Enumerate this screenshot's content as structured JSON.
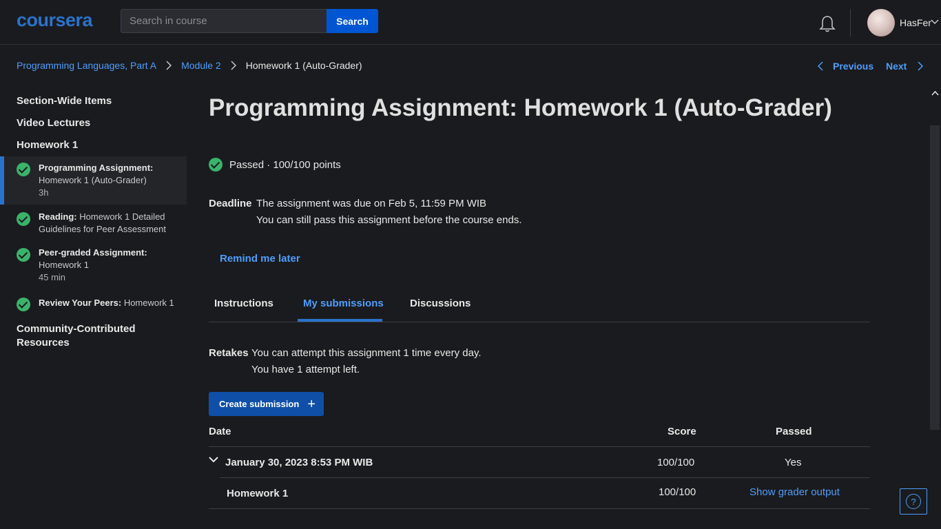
{
  "header": {
    "logo": "coursera",
    "search_placeholder": "Search in course",
    "search_button": "Search",
    "username": "HasFer"
  },
  "breadcrumb": {
    "items": [
      "Programming Languages, Part A",
      "Module 2"
    ],
    "current": "Homework 1 (Auto-Grader)",
    "previous": "Previous",
    "next": "Next"
  },
  "sidebar": {
    "sections": [
      "Section-Wide Items",
      "Video Lectures",
      "Homework 1",
      "Community-Contributed Resources"
    ],
    "items": [
      {
        "type": "Programming Assignment:",
        "title": "Homework 1 (Auto-Grader)",
        "duration": "3h"
      },
      {
        "type": "Reading:",
        "title": "Homework 1 Detailed Guidelines for Peer Assessment",
        "duration": ""
      },
      {
        "type": "Peer-graded Assignment:",
        "title": "Homework 1",
        "duration": "45 min"
      },
      {
        "type": "Review Your Peers:",
        "title": "Homework 1",
        "duration": ""
      }
    ]
  },
  "main": {
    "title": "Programming Assignment: Homework 1 (Auto-Grader)",
    "status": "Passed · 100/100 points",
    "deadline_label": "Deadline",
    "deadline_line1": "The assignment was due on Feb 5, 11:59 PM WIB",
    "deadline_line2": "You can still pass this assignment before the course ends.",
    "remind": "Remind me later",
    "tabs": [
      "Instructions",
      "My submissions",
      "Discussions"
    ],
    "retakes_label": "Retakes",
    "retakes_line1": "You can attempt this assignment 1 time every day.",
    "retakes_line2": "You have 1 attempt left.",
    "create_button": "Create submission",
    "table": {
      "headers": [
        "Date",
        "Score",
        "Passed"
      ],
      "submission": {
        "date": "January 30, 2023 8:53 PM WIB",
        "score": "100/100",
        "passed": "Yes"
      },
      "part": {
        "name": "Homework 1",
        "score": "100/100",
        "link": "Show grader output"
      }
    }
  },
  "colors": {
    "accent": "#2a73cc",
    "link": "#4d9eff",
    "success": "#3ab36b",
    "background": "#1a1b1e"
  },
  "help_icon": "?"
}
